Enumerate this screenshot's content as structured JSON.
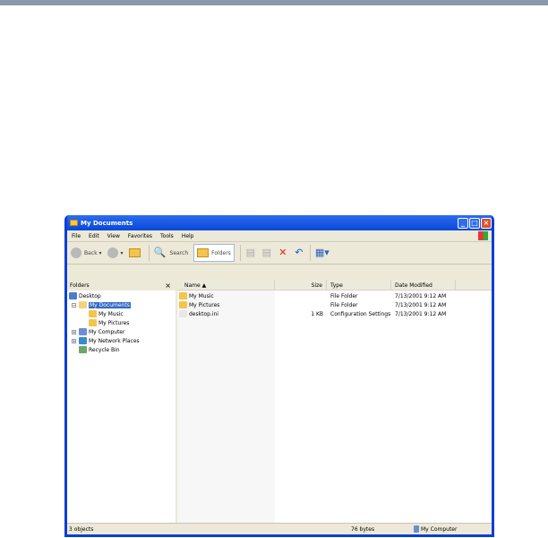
{
  "window": {
    "title": "My Documents"
  },
  "menu": [
    "File",
    "Edit",
    "View",
    "Favorites",
    "Tools",
    "Help"
  ],
  "toolbar": {
    "back": "Back",
    "search": "Search",
    "folders": "Folders"
  },
  "folders_pane": {
    "title": "Folders",
    "close": "×",
    "tree": [
      {
        "label": "Desktop",
        "indent": 0,
        "expander": "",
        "color": "#4a7fd0"
      },
      {
        "label": "My Documents",
        "indent": 1,
        "expander": "−",
        "color": "#f3d37a",
        "selected": true
      },
      {
        "label": "My Music",
        "indent": 2,
        "expander": "",
        "color": "#f3c54d"
      },
      {
        "label": "My Pictures",
        "indent": 2,
        "expander": "",
        "color": "#f3c54d"
      },
      {
        "label": "My Computer",
        "indent": 1,
        "expander": "+",
        "color": "#6b8fd0"
      },
      {
        "label": "My Network Places",
        "indent": 1,
        "expander": "+",
        "color": "#3a8ad0"
      },
      {
        "label": "Recycle Bin",
        "indent": 1,
        "expander": "",
        "color": "#6aa86a"
      }
    ]
  },
  "list": {
    "columns": [
      "Name ▲",
      "Size",
      "Type",
      "Date Modified"
    ],
    "rows": [
      {
        "name": "My Music",
        "size": "",
        "type": "File Folder",
        "date": "7/13/2001 9:12 AM",
        "color": "#f3c54d"
      },
      {
        "name": "My Pictures",
        "size": "",
        "type": "File Folder",
        "date": "7/13/2001 9:12 AM",
        "color": "#f3c54d"
      },
      {
        "name": "desktop.ini",
        "size": "1 KB",
        "type": "Configuration Settings",
        "date": "7/13/2001 9:12 AM",
        "color": "#e8e8e8"
      }
    ]
  },
  "status": {
    "objects": "3 objects",
    "bytes": "76 bytes",
    "location": "My Computer"
  }
}
